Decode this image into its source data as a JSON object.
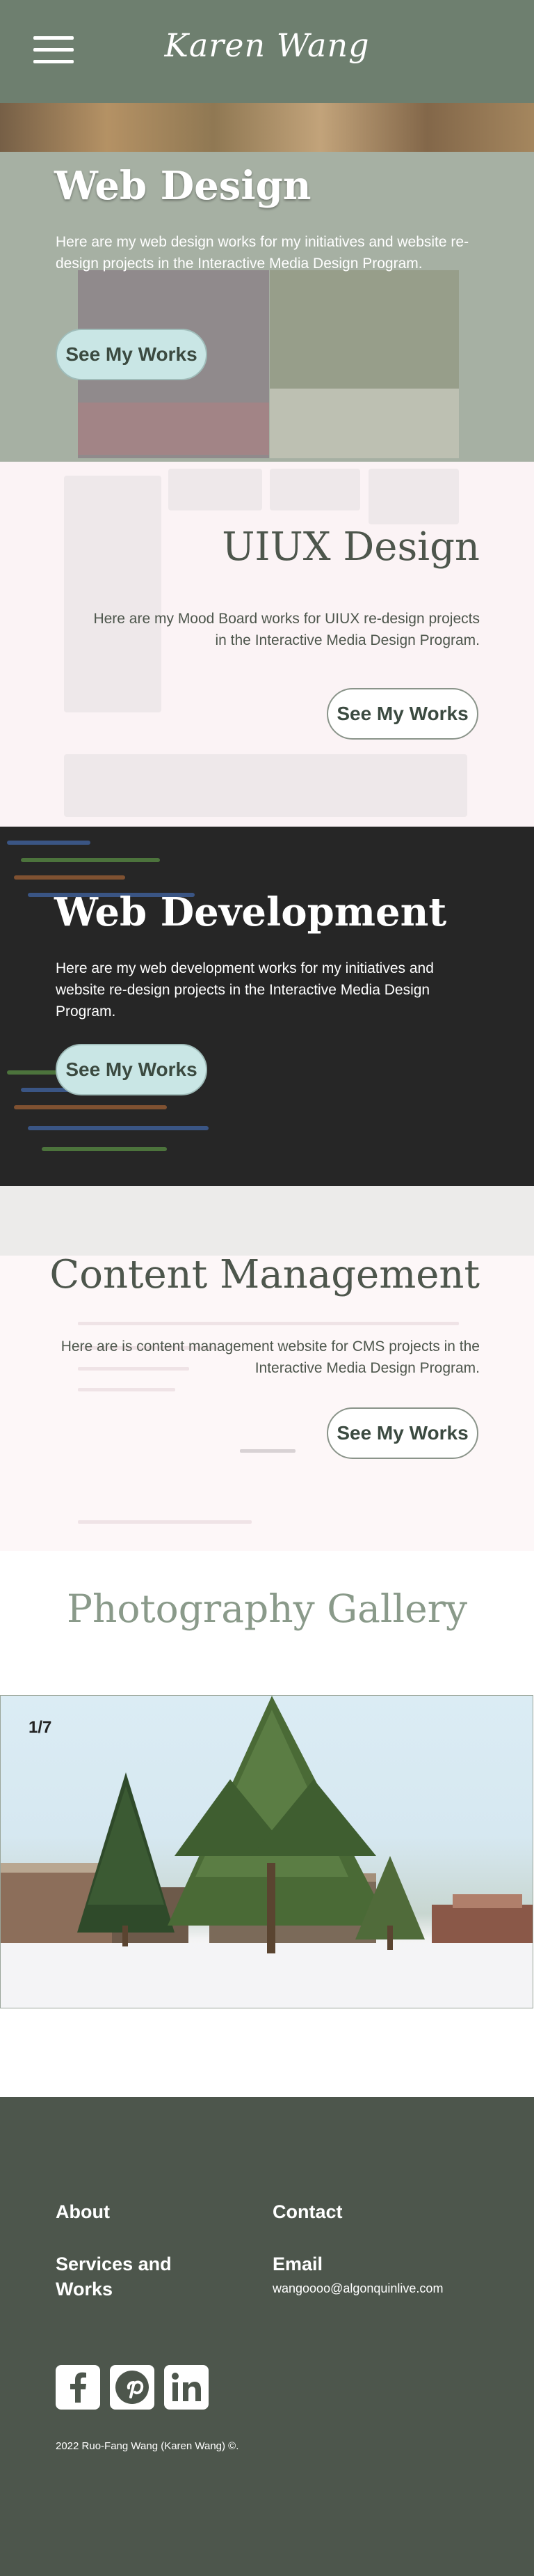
{
  "header": {
    "logo_text": "Karen Wang",
    "menu_icon": "hamburger-menu-icon"
  },
  "web_design": {
    "title": "Web Design",
    "description": "Here are my web design works for my initiatives and website re-design projects in the Interactive Media Design Program.",
    "button": "See My Works"
  },
  "uiux": {
    "title": "UIUX Design",
    "description": "Here are my Mood Board works for UIUX re-design projects in the Interactive Media Design Program.",
    "button": "See My Works"
  },
  "web_dev": {
    "title": "Web Development",
    "description": "Here are my web development works for my initiatives and website re-design projects in the Interactive Media Design Program.",
    "button": "See My Works"
  },
  "cms": {
    "title": "Content Management",
    "description": "Here are is content management website for CMS projects in the Interactive Media Design Program.",
    "button": "See My Works"
  },
  "gallery": {
    "title": "Photography Gallery",
    "counter": "1/7"
  },
  "footer": {
    "about": "About",
    "contact": "Contact",
    "services": "Services and Works",
    "email_label": "Email",
    "email": "wangoooo@algonquinlive.com",
    "copyright": "2022 Ruo-Fang Wang (Karen Wang) ©.",
    "social_icons": [
      "facebook-icon",
      "pinterest-icon",
      "linkedin-icon"
    ]
  },
  "colors": {
    "header_bg": "#6e7f6f",
    "button_light": "#c9e6e5",
    "footer_bg": "#4d564c",
    "title_dark": "#4d564c",
    "gallery_title": "#8a9a8a"
  }
}
